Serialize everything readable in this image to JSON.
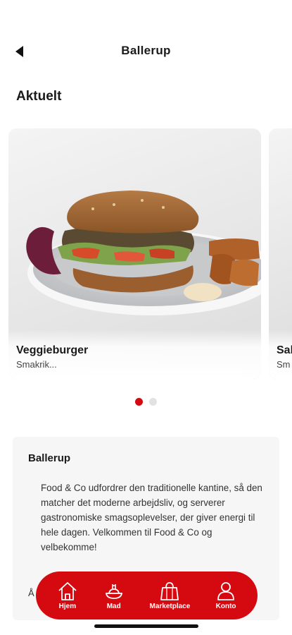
{
  "header": {
    "title": "Ballerup",
    "back_icon": "back-arrow-icon"
  },
  "section": {
    "title": "Aktuelt"
  },
  "carousel": {
    "cards": [
      {
        "title": "Veggieburger",
        "subtitle": "Smakrik..."
      },
      {
        "title": "Sal",
        "subtitle": "Sm"
      }
    ],
    "active_index": 0,
    "dot_count": 2,
    "accent": "#d50a11"
  },
  "info": {
    "title": "Ballerup",
    "body": "Food & Co udfordrer den traditionelle kantine, så den matcher det moderne arbejdsliv, og serverer gastronomiske smagsoplevelser, der giver energi til hele dagen. Velkommen til Food & Co og velbekomme!",
    "peek": "Å"
  },
  "nav": {
    "background": "#d50a11",
    "items": [
      {
        "label": "Hjem",
        "icon": "home-icon"
      },
      {
        "label": "Mad",
        "icon": "food-icon"
      },
      {
        "label": "Marketplace",
        "icon": "shopping-bag-icon"
      },
      {
        "label": "Konto",
        "icon": "account-icon"
      }
    ]
  }
}
